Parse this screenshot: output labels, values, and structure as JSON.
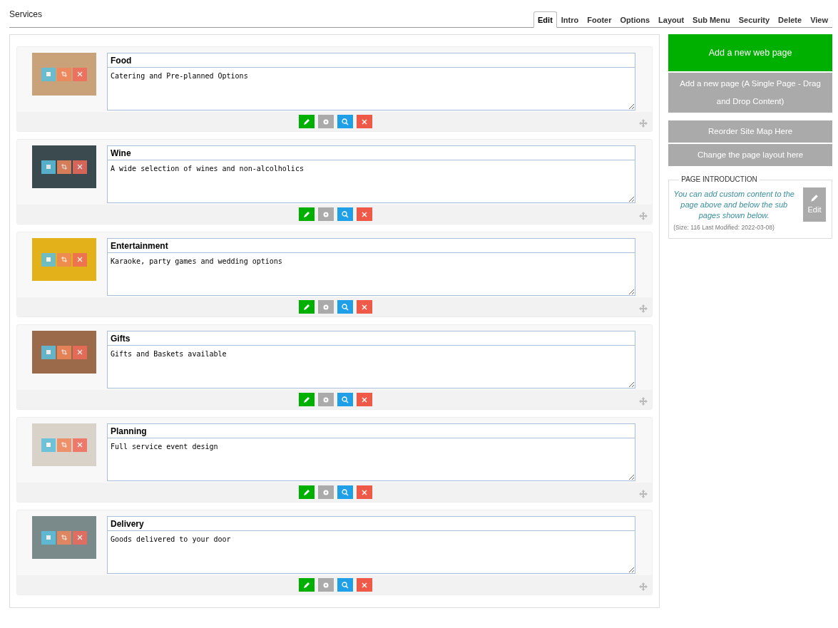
{
  "page_title": "Services",
  "tabs": [
    {
      "label": "Edit",
      "selected": true
    },
    {
      "label": "Intro",
      "selected": false
    },
    {
      "label": "Footer",
      "selected": false
    },
    {
      "label": "Options",
      "selected": false
    },
    {
      "label": "Layout",
      "selected": false
    },
    {
      "label": "Sub Menu",
      "selected": false
    },
    {
      "label": "Security",
      "selected": false
    },
    {
      "label": "Delete",
      "selected": false
    },
    {
      "label": "View",
      "selected": false
    }
  ],
  "pages": [
    {
      "title": "Food",
      "description": "Catering and Pre-planned Options"
    },
    {
      "title": "Wine",
      "description": "A wide selection of wines and non-alcolholics"
    },
    {
      "title": "Entertainment",
      "description": "Karaoke, party games and wedding options"
    },
    {
      "title": "Gifts",
      "description": "Gifts and Baskets available"
    },
    {
      "title": "Planning",
      "description": "Full service event design"
    },
    {
      "title": "Delivery",
      "description": "Goods delivered to your door"
    }
  ],
  "sidebar_groups": [
    [
      {
        "label": "Add a new web page",
        "kind": "primary"
      },
      {
        "label": "Add a new page (A Single Page - Drag and Drop Content)",
        "kind": "secondary"
      }
    ],
    [
      {
        "label": "Reorder Site Map Here",
        "kind": "secondary"
      },
      {
        "label": "Change the page layout here",
        "kind": "secondary"
      }
    ]
  ],
  "page_introduction": {
    "legend": "PAGE INTRODUCTION",
    "text": "You can add custom content to the page above and below the sub pages shown below.",
    "edit_label": "Edit",
    "meta": "(Size: 116 Last Modified: 2022-03-08)"
  }
}
